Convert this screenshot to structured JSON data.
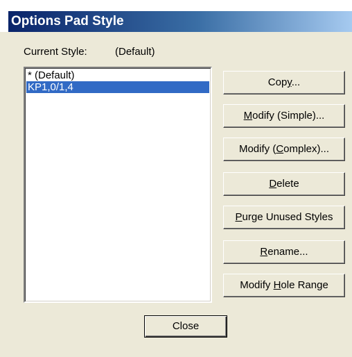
{
  "window": {
    "title": "Options Pad Style"
  },
  "current_style": {
    "label": "Current Style:",
    "value": "(Default)"
  },
  "styles_list": {
    "items": [
      {
        "label": "* (Default)",
        "selected": false
      },
      {
        "label": "KP1,0/1,4",
        "selected": true
      }
    ]
  },
  "buttons": {
    "copy": {
      "pre": "Cop",
      "key": "y",
      "post": "..."
    },
    "modify_simple": {
      "pre": "",
      "key": "M",
      "post": "odify (Simple)..."
    },
    "modify_complex": {
      "pre": "Modify (",
      "key": "C",
      "post": "omplex)..."
    },
    "delete": {
      "pre": "",
      "key": "D",
      "post": "elete"
    },
    "purge": {
      "pre": "",
      "key": "P",
      "post": "urge Unused Styles"
    },
    "rename": {
      "pre": "",
      "key": "R",
      "post": "ename..."
    },
    "modify_hole_range": {
      "pre": "Modify ",
      "key": "H",
      "post": "ole Range"
    },
    "close": "Close"
  },
  "colors": {
    "title_gradient_start": "#0a246a",
    "title_gradient_end": "#a6caf0",
    "selection": "#316ac5",
    "dialog_face": "#ece9d8"
  }
}
